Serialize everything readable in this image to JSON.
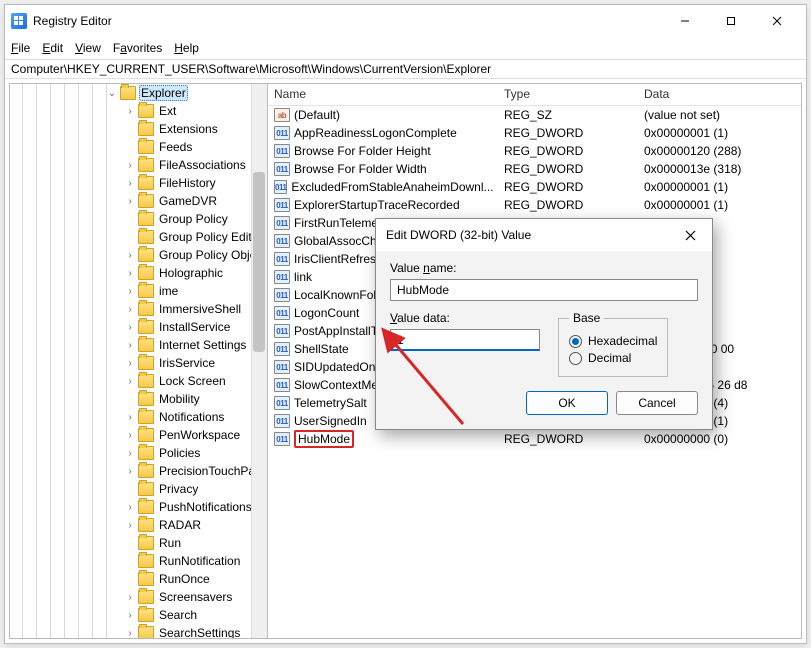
{
  "window": {
    "title": "Registry Editor",
    "minimize": "—",
    "maximize": "☐",
    "close": "✕"
  },
  "menu": {
    "file": "File",
    "edit": "Edit",
    "view": "View",
    "favorites": "Favorites",
    "help": "Help"
  },
  "address": "Computer\\HKEY_CURRENT_USER\\Software\\Microsoft\\Windows\\CurrentVersion\\Explorer",
  "tree": [
    {
      "label": "Explorer",
      "exp": "v",
      "selected": true
    },
    {
      "label": "Ext",
      "exp": ">"
    },
    {
      "label": "Extensions",
      "exp": ""
    },
    {
      "label": "Feeds",
      "exp": ""
    },
    {
      "label": "FileAssociations",
      "exp": ">"
    },
    {
      "label": "FileHistory",
      "exp": ">"
    },
    {
      "label": "GameDVR",
      "exp": ">"
    },
    {
      "label": "Group Policy",
      "exp": ""
    },
    {
      "label": "Group Policy Editor",
      "exp": ""
    },
    {
      "label": "Group Policy Objec",
      "exp": ">"
    },
    {
      "label": "Holographic",
      "exp": ">"
    },
    {
      "label": "ime",
      "exp": ">"
    },
    {
      "label": "ImmersiveShell",
      "exp": ">"
    },
    {
      "label": "InstallService",
      "exp": ">"
    },
    {
      "label": "Internet Settings",
      "exp": ">"
    },
    {
      "label": "IrisService",
      "exp": ">"
    },
    {
      "label": "Lock Screen",
      "exp": ">"
    },
    {
      "label": "Mobility",
      "exp": ""
    },
    {
      "label": "Notifications",
      "exp": ">"
    },
    {
      "label": "PenWorkspace",
      "exp": ">"
    },
    {
      "label": "Policies",
      "exp": ">"
    },
    {
      "label": "PrecisionTouchPad",
      "exp": ">"
    },
    {
      "label": "Privacy",
      "exp": ""
    },
    {
      "label": "PushNotifications",
      "exp": ">"
    },
    {
      "label": "RADAR",
      "exp": ">"
    },
    {
      "label": "Run",
      "exp": ""
    },
    {
      "label": "RunNotification",
      "exp": ""
    },
    {
      "label": "RunOnce",
      "exp": ""
    },
    {
      "label": "Screensavers",
      "exp": ">"
    },
    {
      "label": "Search",
      "exp": ">"
    },
    {
      "label": "SearchSettings",
      "exp": ">"
    }
  ],
  "columns": {
    "name": "Name",
    "type": "Type",
    "data": "Data"
  },
  "values": [
    {
      "icon": "sz",
      "name": "(Default)",
      "type": "REG_SZ",
      "data": "(value not set)"
    },
    {
      "icon": "dw",
      "name": "AppReadinessLogonComplete",
      "type": "REG_DWORD",
      "data": "0x00000001 (1)"
    },
    {
      "icon": "dw",
      "name": "Browse For Folder Height",
      "type": "REG_DWORD",
      "data": "0x00000120 (288)"
    },
    {
      "icon": "dw",
      "name": "Browse For Folder Width",
      "type": "REG_DWORD",
      "data": "0x0000013e (318)"
    },
    {
      "icon": "dw",
      "name": "ExcludedFromStableAnaheimDownl...",
      "type": "REG_DWORD",
      "data": "0x00000001 (1)"
    },
    {
      "icon": "dw",
      "name": "ExplorerStartupTraceRecorded",
      "type": "REG_DWORD",
      "data": "0x00000001 (1)"
    },
    {
      "icon": "dw",
      "name": "FirstRunTelemet",
      "type": "",
      "data": ""
    },
    {
      "icon": "dw",
      "name": "GlobalAssocCha",
      "type": "",
      "data": ")"
    },
    {
      "icon": "dw",
      "name": "IrisClientRefresh",
      "type": "",
      "data": ""
    },
    {
      "icon": "dw",
      "name": "link",
      "type": "",
      "data": ""
    },
    {
      "icon": "dw",
      "name": "LocalKnownFol",
      "type": "",
      "data": ""
    },
    {
      "icon": "dw",
      "name": "LogonCount",
      "type": "",
      "data": ""
    },
    {
      "icon": "dw",
      "name": "PostAppInstallTa",
      "type": "",
      "data": ""
    },
    {
      "icon": "dw",
      "name": "ShellState",
      "type": "",
      "data": "8 00 00 00 00 00"
    },
    {
      "icon": "dw",
      "name": "SIDUpdatedOnL",
      "type": "",
      "data": ""
    },
    {
      "icon": "dw",
      "name": "SlowContextMe",
      "type": "",
      "data": "1 a5 4d af a5 26 d8"
    },
    {
      "icon": "dw",
      "name": "TelemetrySalt",
      "type": "REG_DWORD",
      "data": "0x00000004 (4)"
    },
    {
      "icon": "dw",
      "name": "UserSignedIn",
      "type": "REG_DWORD",
      "data": "0x00000001 (1)"
    },
    {
      "icon": "dw",
      "name": "HubMode",
      "type": "REG_DWORD",
      "data": "0x00000000 (0)",
      "highlight": true
    }
  ],
  "dialog": {
    "title": "Edit DWORD (32-bit) Value",
    "value_name_label": "Value name:",
    "value_name": "HubMode",
    "value_data_label": "Value data:",
    "value_data": "1",
    "base_label": "Base",
    "hex": "Hexadecimal",
    "dec": "Decimal",
    "ok": "OK",
    "cancel": "Cancel"
  }
}
